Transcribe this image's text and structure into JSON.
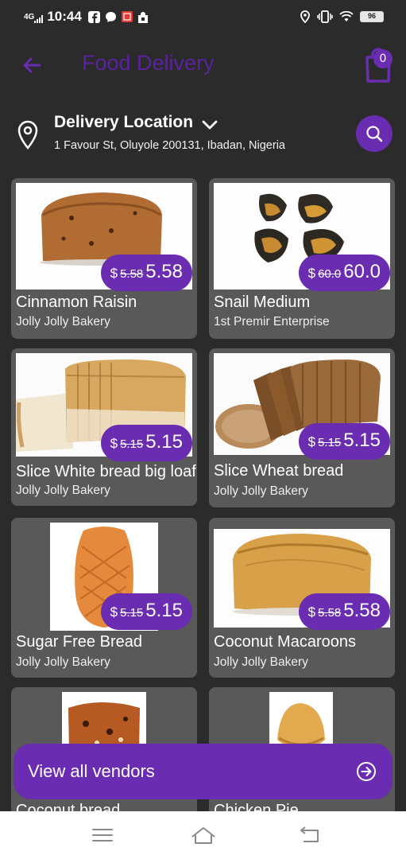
{
  "status_bar": {
    "network": "4G",
    "time": "10:44",
    "battery": "96",
    "icons": [
      "facebook-icon",
      "messenger-icon",
      "app-notification-icon",
      "shopping-bag-icon",
      "location-icon",
      "vibrate-icon",
      "wifi-icon",
      "battery-icon"
    ]
  },
  "header": {
    "title": "Food Delivery",
    "cart_count": "0",
    "icons": [
      "back-arrow-icon",
      "shopping-bag-icon"
    ]
  },
  "location": {
    "title": "Delivery Location",
    "address": "1 Favour St, Oluyole 200131, Ibadan, Nigeria",
    "icons": [
      "map-pin-icon",
      "chevron-down-icon",
      "search-icon"
    ]
  },
  "products": [
    {
      "name": "Cinnamon Raisin",
      "vendor": "Jolly Jolly Bakery",
      "currency": "$",
      "old_price": "5.58",
      "price": "5.58"
    },
    {
      "name": "Snail Medium",
      "vendor": "1st Premir Enterprise",
      "currency": "$",
      "old_price": "60.0",
      "price": "60.0"
    },
    {
      "name": "Slice White bread big loaf",
      "vendor": "Jolly Jolly Bakery",
      "currency": "$",
      "old_price": "5.15",
      "price": "5.15"
    },
    {
      "name": "Slice Wheat bread",
      "vendor": "Jolly Jolly Bakery",
      "currency": "$",
      "old_price": "5.15",
      "price": "5.15"
    },
    {
      "name": "Sugar Free Bread",
      "vendor": "Jolly Jolly Bakery",
      "currency": "$",
      "old_price": "5.15",
      "price": "5.15"
    },
    {
      "name": "Coconut Macaroons",
      "vendor": "Jolly Jolly Bakery",
      "currency": "$",
      "old_price": "5.58",
      "price": "5.58"
    },
    {
      "name": "Coconut bread",
      "vendor": "",
      "currency": "",
      "old_price": "",
      "price": ""
    },
    {
      "name": "Chicken Pie",
      "vendor": "",
      "currency": "",
      "old_price": "",
      "price": ""
    }
  ],
  "vendors_button": {
    "label": "View all vendors",
    "icon": "arrow-right-circle-icon"
  },
  "nav_bar": {
    "icons": [
      "menu-icon",
      "home-icon",
      "back-icon"
    ]
  },
  "colors": {
    "background": "#2b2b2b",
    "card": "#595959",
    "accent": "#6a2cb0",
    "title": "#5b22a0"
  }
}
